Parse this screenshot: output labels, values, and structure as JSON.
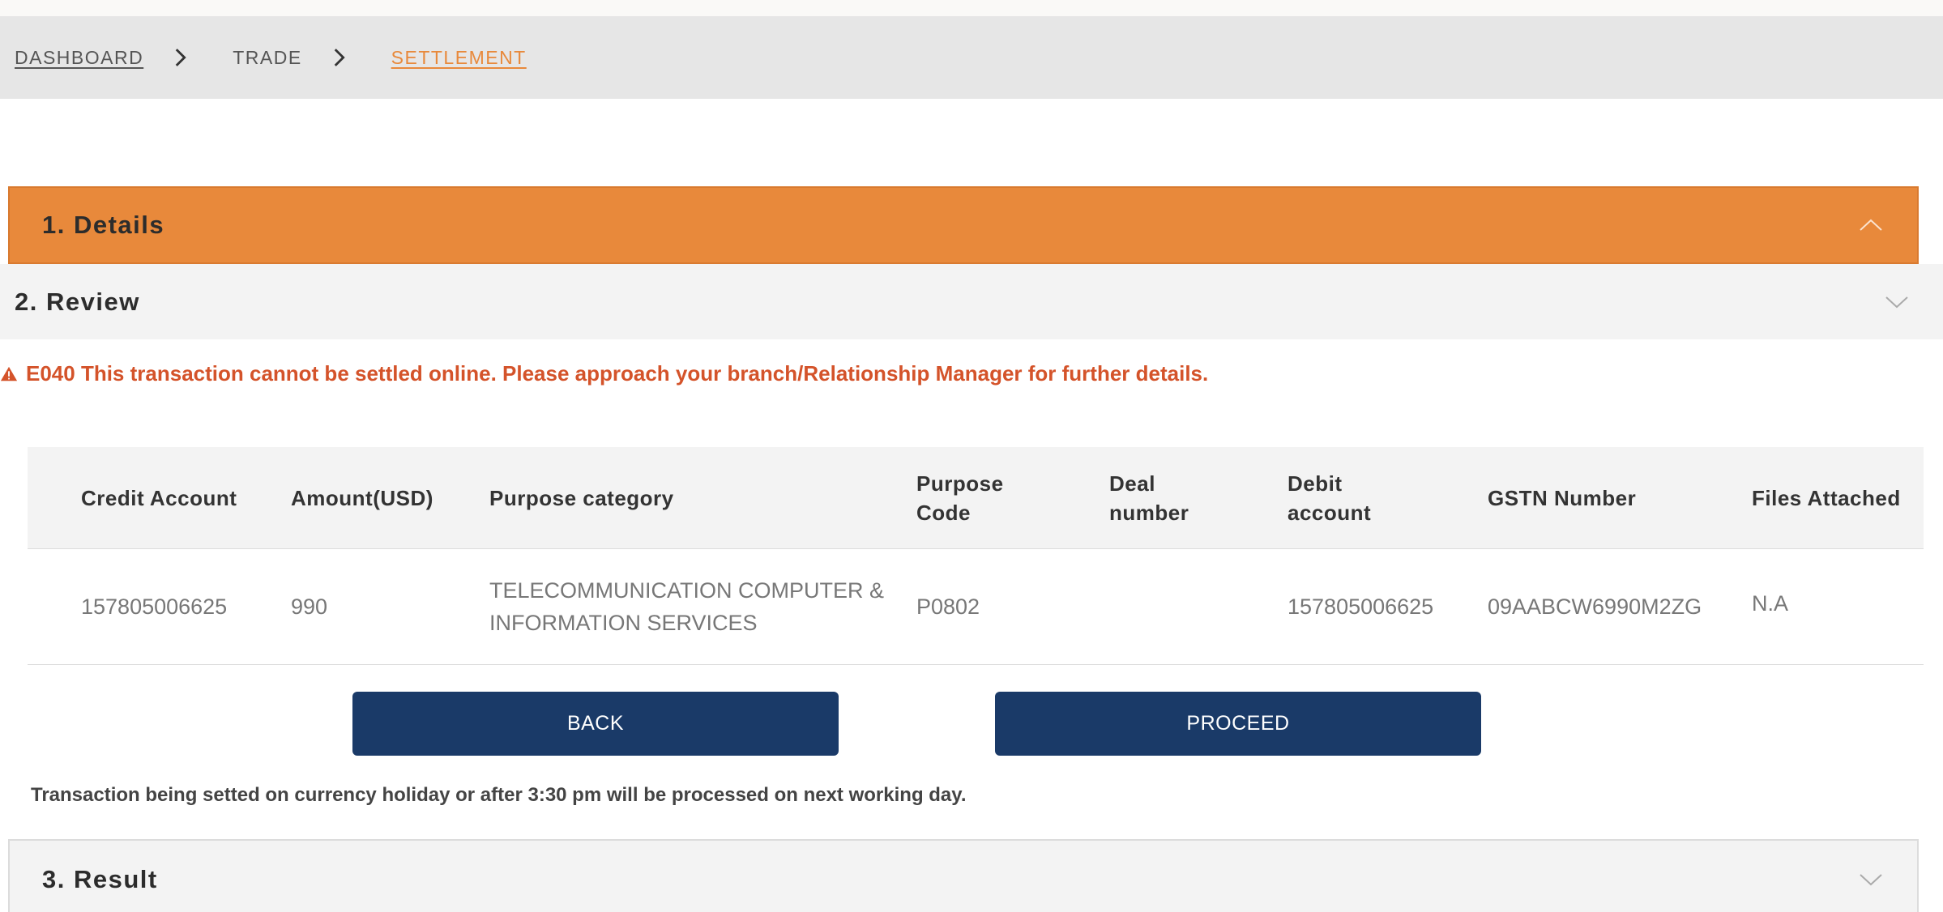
{
  "breadcrumb": {
    "items": [
      "DASHBOARD",
      "TRADE",
      "SETTLEMENT"
    ]
  },
  "sections": {
    "details": "1. Details",
    "review": "2. Review",
    "result": "3. Result"
  },
  "error": {
    "message": "E040 This transaction cannot be settled online. Please approach your branch/Relationship Manager for further details."
  },
  "table": {
    "headers": [
      "Credit Account",
      "Amount(USD)",
      "Purpose category",
      "Purpose Code",
      "Deal number",
      "Debit account",
      "GSTN Number",
      "Files Attached"
    ],
    "rows": [
      [
        "157805006625",
        "990",
        "TELECOMMUNICATION COMPUTER & INFORMATION SERVICES",
        "P0802",
        "",
        "157805006625",
        "09AABCW6990M2ZG",
        "N.A"
      ]
    ]
  },
  "buttons": {
    "back": "BACK",
    "proceed": "PROCEED"
  },
  "note": "Transaction being setted on currency holiday or after 3:30 pm will be processed on next working day.",
  "colors": {
    "accent": "#e8893b",
    "error": "#d4532a",
    "button": "#1a3a68"
  },
  "icons": [
    "chevron-right-icon",
    "chevron-up-icon",
    "chevron-down-icon",
    "warning-icon"
  ]
}
